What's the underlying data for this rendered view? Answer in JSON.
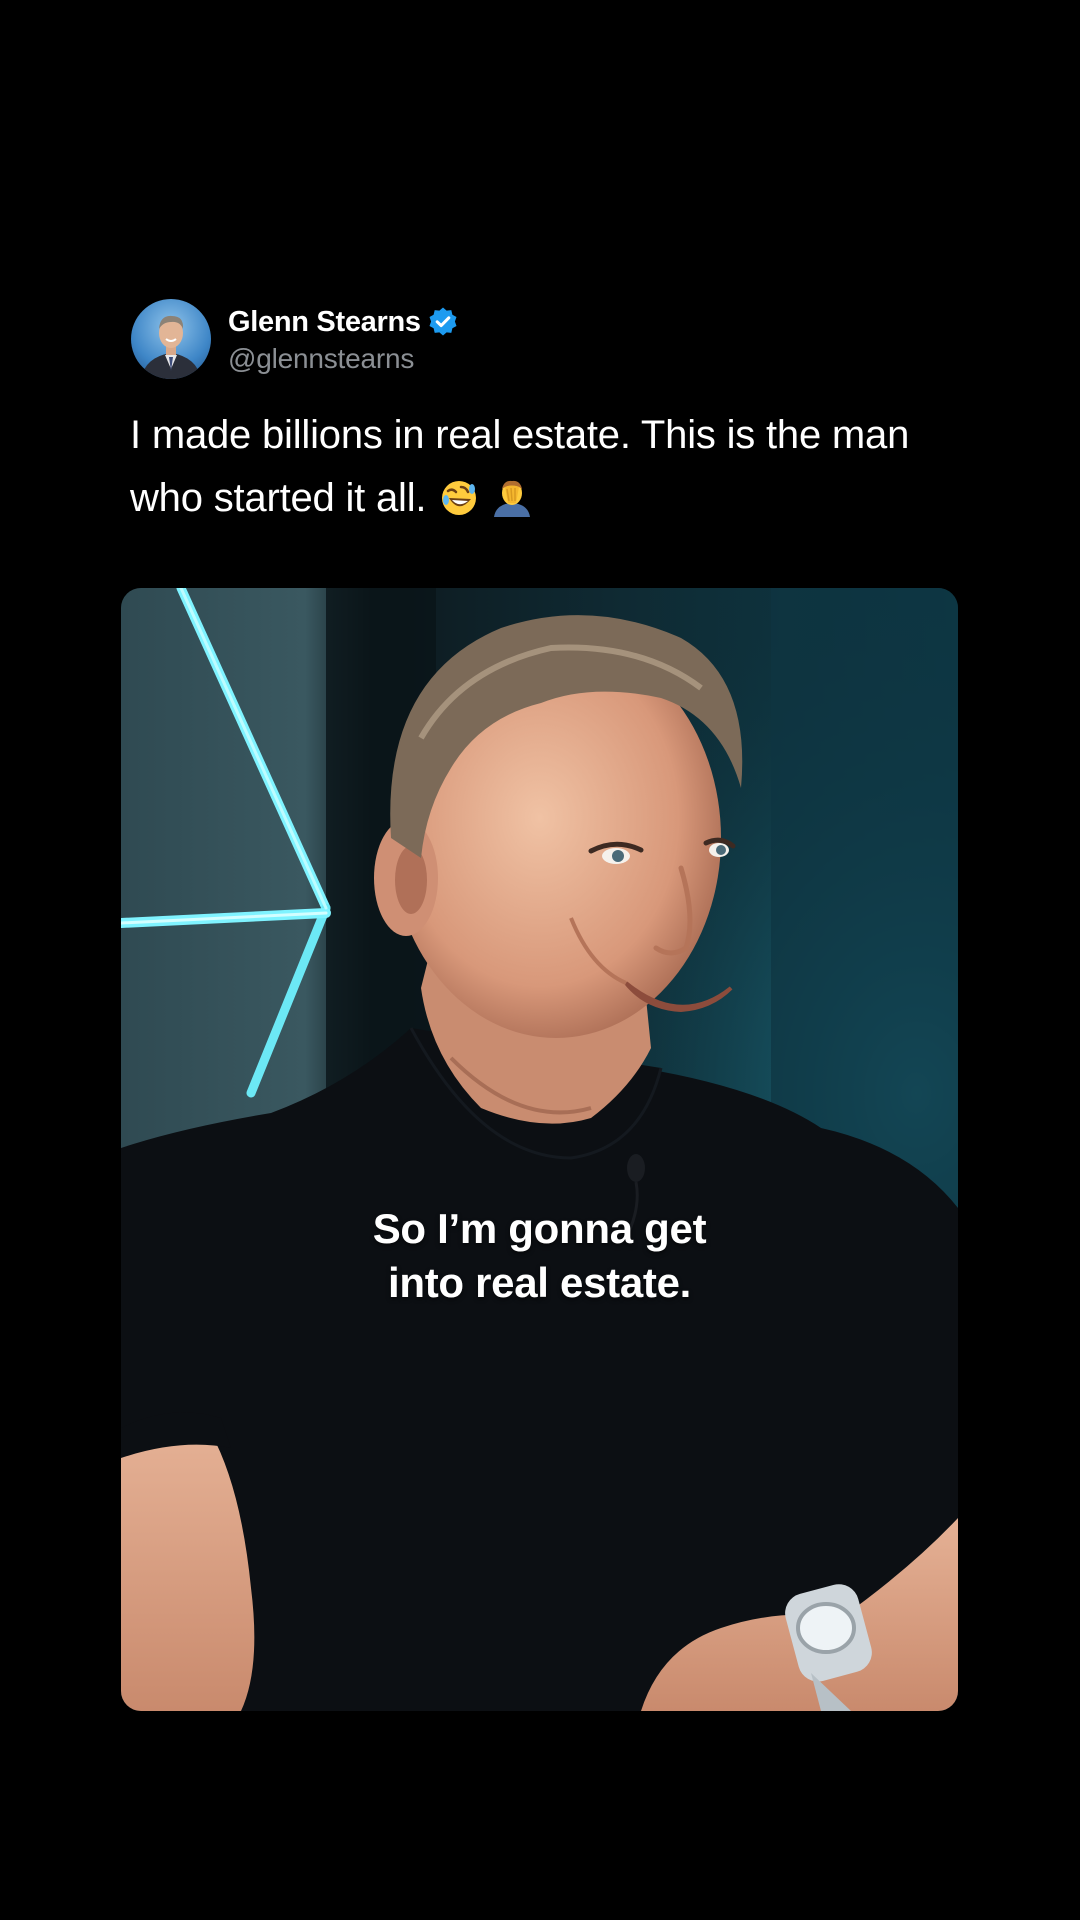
{
  "tweet": {
    "author_name": "Glenn Stearns",
    "author_handle": "@glennstearns",
    "verified": true,
    "text": "I made billions in real estate. This is the man who started it all.",
    "emojis": [
      "rolling-on-floor-laughing-emoji",
      "man-facepalming-emoji"
    ]
  },
  "media": {
    "type": "video",
    "caption_line1": "So I’m gonna get",
    "caption_line2": "into real estate."
  },
  "colors": {
    "background": "#000000",
    "text": "#ffffff",
    "handle": "#8b8f94",
    "verified": "#1d9bf0",
    "accent_light": "#4fe3f0"
  }
}
